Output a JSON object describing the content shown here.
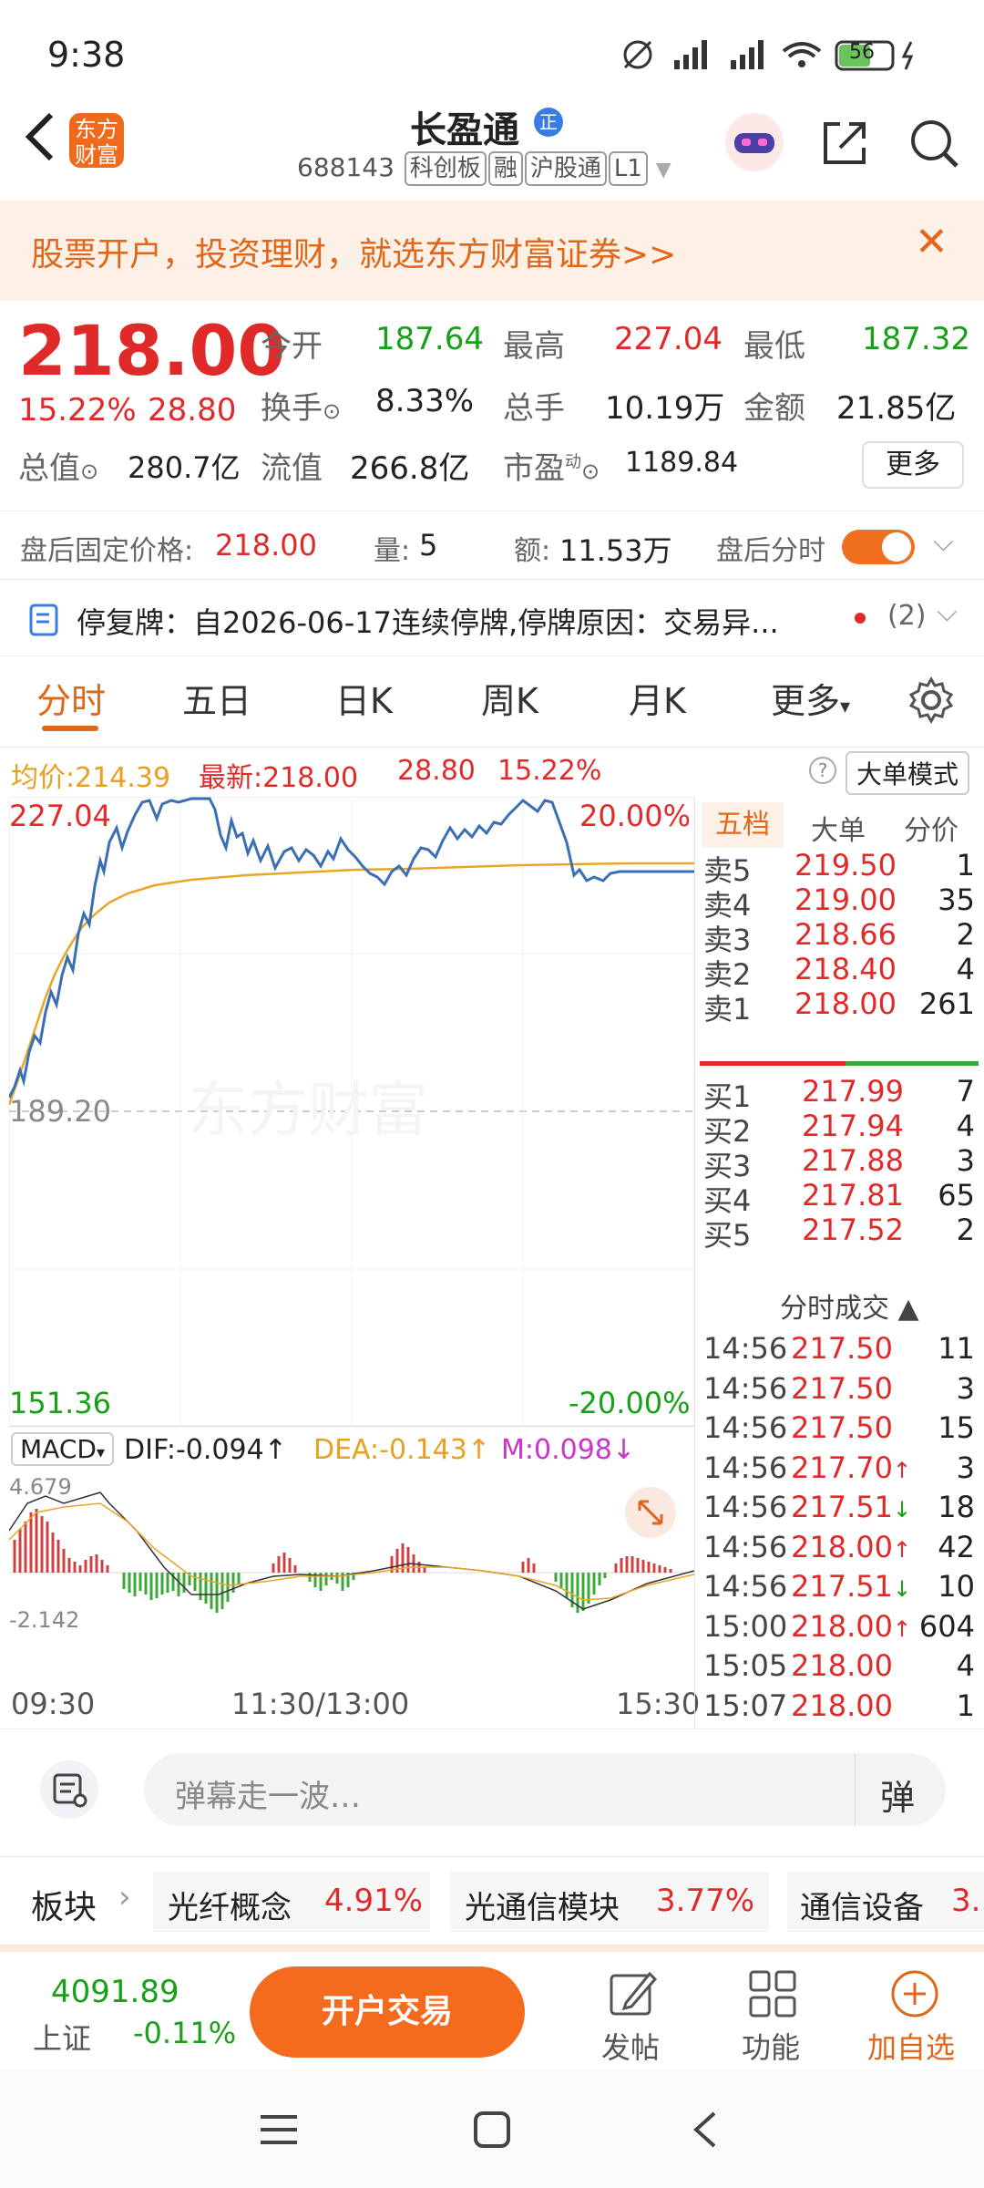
{
  "status": {
    "time": "9:38",
    "battery": "56"
  },
  "header": {
    "brand_logo_text": "东方财富",
    "title": "长盈通",
    "badge": "正",
    "code": "688143",
    "tags": [
      "科创板",
      "融",
      "沪股通",
      "L1"
    ]
  },
  "banner": {
    "text": "股票开户，投资理财，就选东方财富证券>>"
  },
  "quote": {
    "price": "218.00",
    "change_pct": "15.22%",
    "change_amt": "28.80",
    "open_label": "今开",
    "open": "187.64",
    "high_label": "最高",
    "high": "227.04",
    "low_label": "最低",
    "low": "187.32",
    "turnover_label": "换手",
    "turnover": "8.33%",
    "volume_label": "总手",
    "volume": "10.19万",
    "amount_label": "金额",
    "amount": "21.85亿",
    "mcap_label": "总值",
    "mcap": "280.7亿",
    "float_label": "流值",
    "float": "266.8亿",
    "pe_label": "市盈",
    "pe_sup": "动",
    "pe": "1189.84",
    "more": "更多"
  },
  "afterhours": {
    "price_label": "盘后固定价格:",
    "price": "218.00",
    "vol_label": "量:",
    "vol": "5",
    "amt_label": "额:",
    "amt": "11.53万",
    "toggle_label": "盘后分时"
  },
  "notice": {
    "text": "停复牌：自2026-06-17连续停牌,停牌原因：交易异...",
    "count": "(2)"
  },
  "tabs": [
    "分时",
    "五日",
    "日K",
    "周K",
    "月K",
    "更多"
  ],
  "intraday": {
    "avg_label": "均价:",
    "avg": "214.39",
    "latest_label": "最新:",
    "latest": "218.00",
    "chg": "28.80",
    "chg_pct": "15.22%",
    "big_order": "大单模式",
    "y_top": "227.04",
    "y_mid": "189.20",
    "y_bot": "151.36",
    "pct_top": "20.00%",
    "pct_bot": "-20.00%",
    "x_labels": [
      "09:30",
      "11:30/13:00",
      "15:30"
    ],
    "watermark": "东方财富"
  },
  "macd": {
    "label": "MACD",
    "dif": "DIF:-0.094",
    "dea": "DEA:-0.143",
    "m": "M:0.098",
    "top": "4.679",
    "bot": "-2.142"
  },
  "orderbook": {
    "tabs": [
      "五档",
      "大单",
      "分价"
    ],
    "asks": [
      {
        "label": "卖5",
        "price": "219.50",
        "vol": "1"
      },
      {
        "label": "卖4",
        "price": "219.00",
        "vol": "35"
      },
      {
        "label": "卖3",
        "price": "218.66",
        "vol": "2"
      },
      {
        "label": "卖2",
        "price": "218.40",
        "vol": "4"
      },
      {
        "label": "卖1",
        "price": "218.00",
        "vol": "261"
      }
    ],
    "bids": [
      {
        "label": "买1",
        "price": "217.99",
        "vol": "7"
      },
      {
        "label": "买2",
        "price": "217.94",
        "vol": "4"
      },
      {
        "label": "买3",
        "price": "217.88",
        "vol": "3"
      },
      {
        "label": "买4",
        "price": "217.81",
        "vol": "65"
      },
      {
        "label": "买5",
        "price": "217.52",
        "vol": "2"
      }
    ],
    "trades_title": "分时成交",
    "trades": [
      {
        "time": "14:56",
        "price": "217.50",
        "arrow": "",
        "vol": "11"
      },
      {
        "time": "14:56",
        "price": "217.50",
        "arrow": "",
        "vol": "3"
      },
      {
        "time": "14:56",
        "price": "217.50",
        "arrow": "",
        "vol": "15"
      },
      {
        "time": "14:56",
        "price": "217.70",
        "arrow": "↑",
        "vol": "3"
      },
      {
        "time": "14:56",
        "price": "217.51",
        "arrow": "↓",
        "vol": "18"
      },
      {
        "time": "14:56",
        "price": "218.00",
        "arrow": "↑",
        "vol": "42"
      },
      {
        "time": "14:56",
        "price": "217.51",
        "arrow": "↓",
        "vol": "10"
      },
      {
        "time": "15:00",
        "price": "218.00",
        "arrow": "↑",
        "vol": "604"
      },
      {
        "time": "15:05",
        "price": "218.00",
        "arrow": "",
        "vol": "4"
      },
      {
        "time": "15:07",
        "price": "218.00",
        "arrow": "",
        "vol": "1"
      }
    ]
  },
  "danmu": {
    "placeholder": "弹幕走一波…",
    "btn": "弹"
  },
  "sectors": {
    "label": "板块",
    "items": [
      {
        "name": "光纤概念",
        "pct": "4.91%"
      },
      {
        "name": "光通信模块",
        "pct": "3.77%"
      },
      {
        "name": "通信设备",
        "pct": "3."
      }
    ]
  },
  "bottom": {
    "index_value": "4091.89",
    "index_name": "上证",
    "index_chg": "-0.11%",
    "trade_btn": "开户交易",
    "post": "发帖",
    "func": "功能",
    "add": "加自选"
  }
}
